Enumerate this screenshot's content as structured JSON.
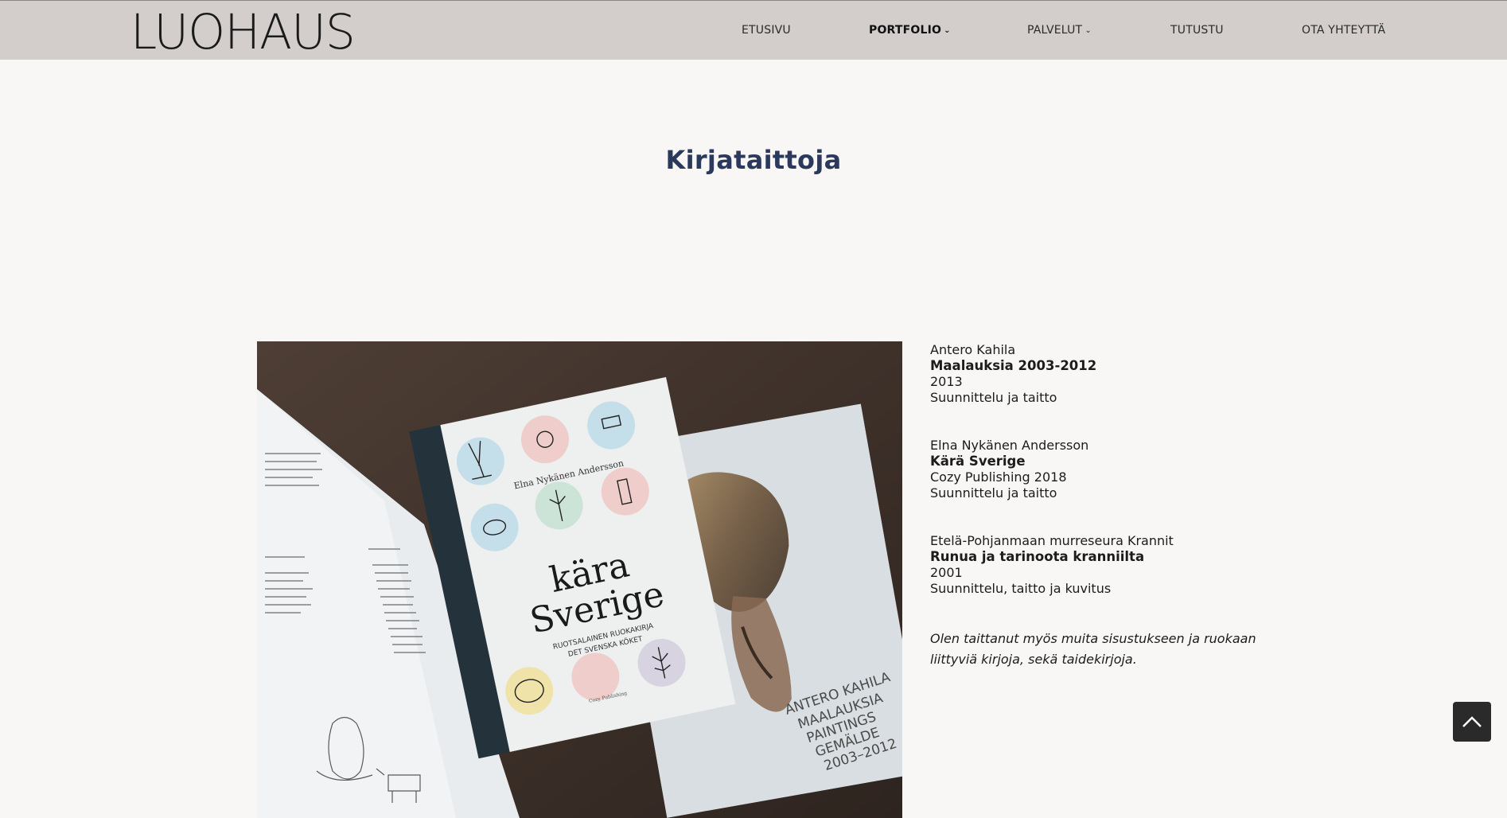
{
  "header": {
    "logo": "LUOHAUS",
    "nav": [
      {
        "label": "ETUSIVU",
        "dropdown": false,
        "active": false
      },
      {
        "label": "PORTFOLIO",
        "dropdown": true,
        "active": true
      },
      {
        "label": "PALVELUT",
        "dropdown": true,
        "active": false
      },
      {
        "label": "TUTUSTU",
        "dropdown": false,
        "active": false
      },
      {
        "label": "OTA YHTEYTTÄ",
        "dropdown": false,
        "active": false
      }
    ]
  },
  "page": {
    "title": "Kirjataittoja"
  },
  "books": [
    {
      "author": "Antero Kahila",
      "title": "Maalauksia 2003-2012",
      "publisher": "2013",
      "role": "Suunnittelu ja taitto"
    },
    {
      "author": "Elna Nykänen Andersson",
      "title": "Kärä Sverige",
      "publisher": "Cozy Publishing 2018",
      "role": "Suunnittelu ja taitto"
    },
    {
      "author": "Etelä-Pohjanmaan murreseura Krannit",
      "title": "Runua ja tarinoota kranniilta",
      "publisher": "2001",
      "role": "Suunnittelu, taitto ja kuvitus"
    }
  ],
  "note": "Olen taittanut myös muita sisustukseen ja ruokaan liittyviä kirjoja, sekä taidekirjoja.",
  "photo": {
    "cover_author": "Elna Nykänen Andersson",
    "cover_title_line1": "kära",
    "cover_title_line2": "Sverige",
    "cover_subtitle_line1": "RUOTSALAINEN RUOKAKIRJA",
    "cover_subtitle_line2": "DET SVENSKA KÖKET",
    "cover_publisher": "Cozy Publishing",
    "second_cover_line1": "ANTERO KAHILA",
    "second_cover_line2": "MAALAUKSIA",
    "second_cover_line3": "PAINTINGS",
    "second_cover_line4": "GEMÄLDE",
    "second_cover_line5": "2003–2012"
  },
  "icons": {
    "to_top": "chevron-up-icon",
    "dropdown": "chevron-down-icon"
  },
  "colors": {
    "header_bg": "#d3cecc",
    "page_bg": "#f8f7f5",
    "title": "#2b3a5c",
    "to_top_bg": "#2a2a2a"
  }
}
